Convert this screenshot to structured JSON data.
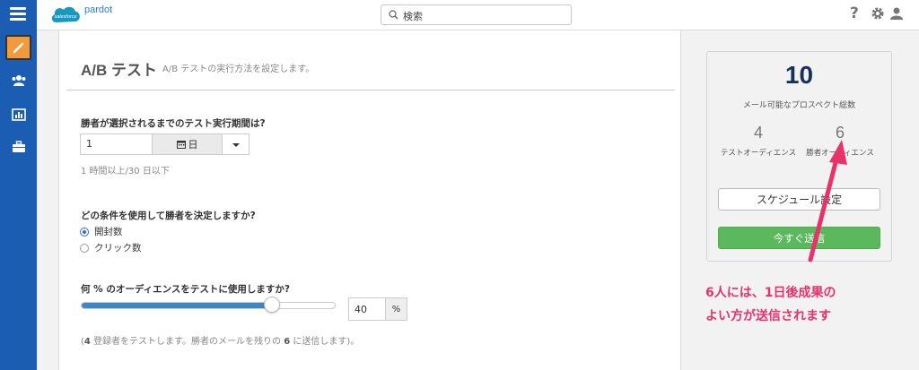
{
  "brand": {
    "name_cloud": "salesforce",
    "name_text": "pardot"
  },
  "search": {
    "placeholder": "検索"
  },
  "page": {
    "title": "A/B テスト",
    "subtitle": "A/B テストの実行方法を設定します。"
  },
  "duration": {
    "question": "勝者が選択されるまでのテスト実行期間は?",
    "value": "1",
    "unit": "日",
    "hint": "1 時間以上/30 日以下"
  },
  "condition": {
    "question": "どの条件を使用して勝者を決定しますか?",
    "options": [
      {
        "label": "開封数",
        "checked": true
      },
      {
        "label": "クリック数",
        "checked": false
      }
    ]
  },
  "audience": {
    "question": "何 % のオーディエンスをテストに使用しますか?",
    "percent_value": "40",
    "percent_unit": "%",
    "slider_fraction": 0.75,
    "summary_prefix": "(",
    "summary_test_count": "4",
    "summary_mid": " 登録者をテストします。勝者のメールを残りの ",
    "summary_rest_count": "6",
    "summary_suffix": " に送信します)。"
  },
  "stats": {
    "total": "10",
    "total_label": "メール可能なプロスペクト総数",
    "test_count": "4",
    "test_label": "テストオーディエンス",
    "winner_count": "6",
    "winner_label": "勝者オーディエンス"
  },
  "buttons": {
    "schedule": "スケジュール設定",
    "send_now": "今すぐ送信"
  },
  "annotation": {
    "line1": "6人には、1日後成果の",
    "line2": "よい方が送信されます"
  },
  "colors": {
    "nav": "#1b5db3",
    "accent": "#f29a3c",
    "send": "#5cb85c",
    "annotation": "#e8326c"
  }
}
